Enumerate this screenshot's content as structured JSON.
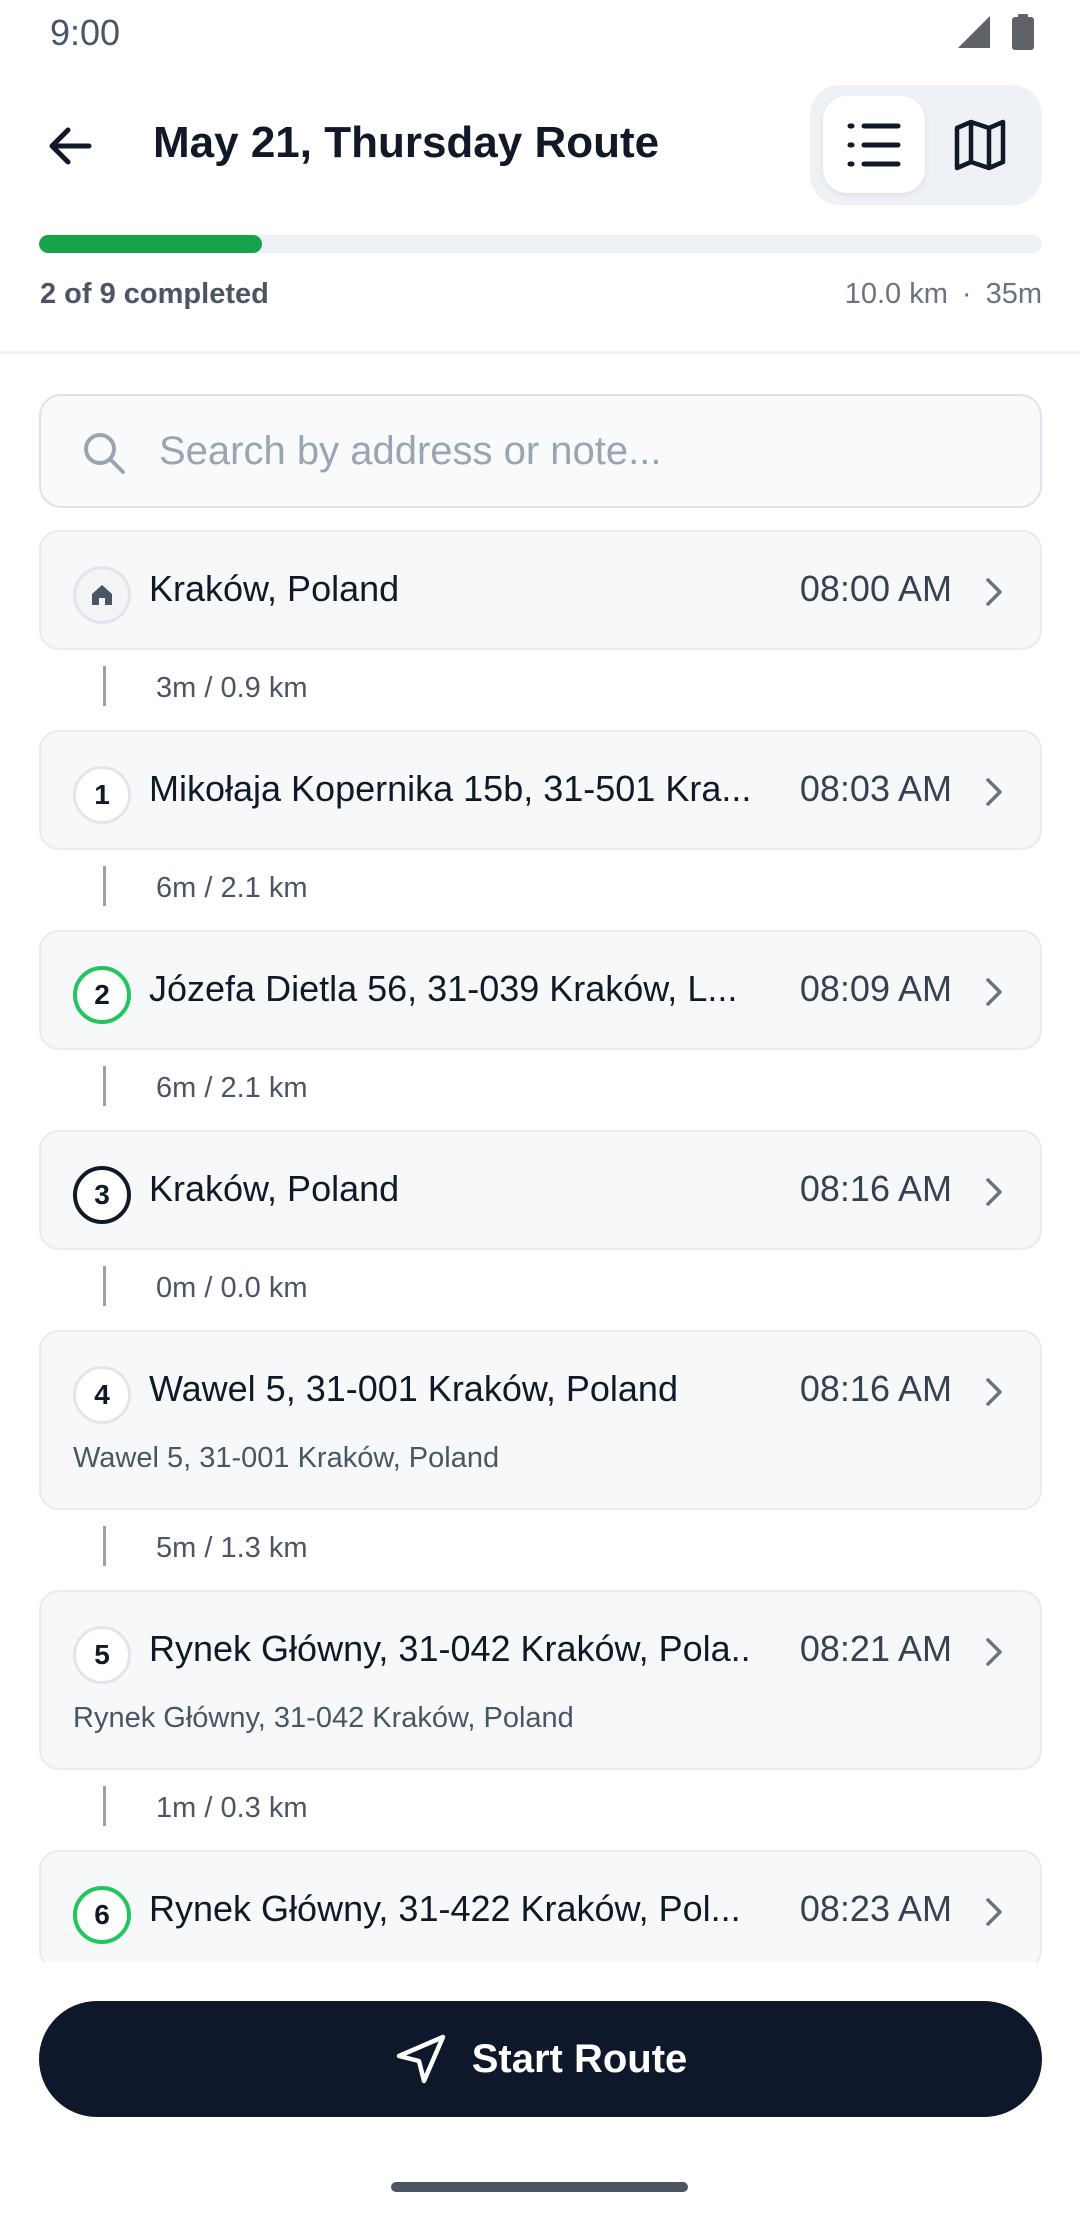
{
  "status_bar": {
    "time": "9:00",
    "icons": [
      "signal-icon",
      "battery-icon"
    ]
  },
  "header": {
    "title": "May 21, Thursday Route",
    "view_modes": [
      "list",
      "map"
    ],
    "active_view": "list"
  },
  "progress": {
    "completed": 2,
    "total": 9,
    "fraction": 0.222,
    "label": "2 of 9 completed",
    "distance": "10.0 km",
    "separator": "·",
    "duration": "35m"
  },
  "search": {
    "placeholder": "Search by address or note..."
  },
  "stops": [
    {
      "badge": "",
      "icon": "home-icon",
      "state": "home",
      "address": "Kraków, Poland",
      "time": "08:00 AM",
      "note": ""
    },
    {
      "badge": "1",
      "state": "pending",
      "address": "Mikołaja Kopernika 15b, 31-501 Kra...",
      "time": "08:03 AM",
      "note": ""
    },
    {
      "badge": "2",
      "state": "done",
      "address": "Józefa Dietla 56, 31-039 Kraków, L...",
      "time": "08:09 AM",
      "note": ""
    },
    {
      "badge": "3",
      "state": "current",
      "address": "Kraków, Poland",
      "time": "08:16 AM",
      "note": ""
    },
    {
      "badge": "4",
      "state": "pending",
      "address": "Wawel 5, 31-001 Kraków, Poland",
      "time": "08:16 AM",
      "note": "Wawel 5, 31-001 Kraków, Poland"
    },
    {
      "badge": "5",
      "state": "pending",
      "address": "Rynek Główny, 31-042 Kraków, Pola..",
      "time": "08:21 AM",
      "note": "Rynek Główny, 31-042 Kraków, Poland"
    },
    {
      "badge": "6",
      "state": "done",
      "address": "Rynek Główny, 31-422 Kraków, Pol...",
      "time": "08:23 AM",
      "note": ""
    }
  ],
  "legs": [
    "3m / 0.9 km",
    "6m / 2.1 km",
    "6m / 2.1 km",
    "0m / 0.0 km",
    "5m / 1.3 km",
    "1m / 0.3 km"
  ],
  "footer": {
    "start_label": "Start Route"
  },
  "colors": {
    "accent_green": "#16a34a",
    "primary_dark": "#0f172a"
  }
}
